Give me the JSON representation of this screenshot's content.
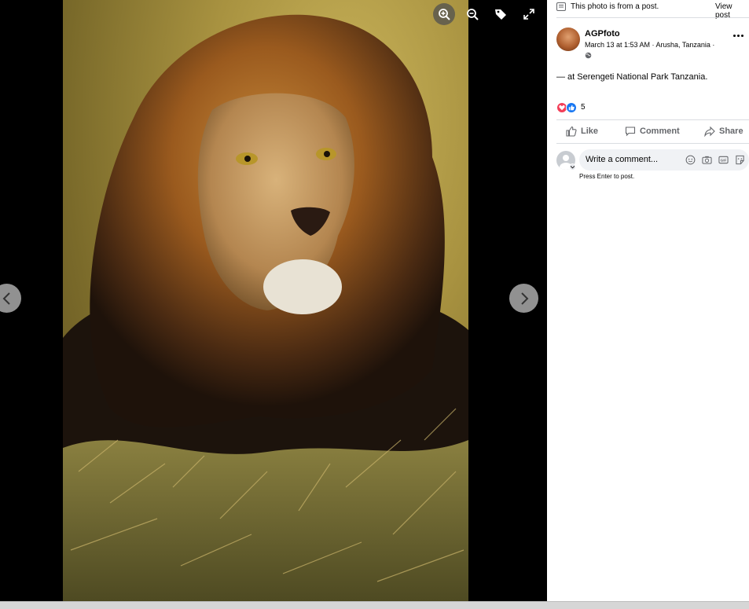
{
  "viewer": {
    "toolbar": {
      "zoom_in": "zoom-in-icon",
      "zoom_out": "zoom-out-icon",
      "tag": "tag-icon",
      "fullscreen": "fullscreen-icon"
    }
  },
  "sidebar": {
    "notice": "This photo is from a post.",
    "view_post": "View post",
    "author": "AGPfoto",
    "meta": "March 13 at 1:53 AM · Arusha, Tanzania ·",
    "caption": "— at Serengeti National Park Tanzania.",
    "reaction_count": "5",
    "actions": {
      "like": "Like",
      "comment": "Comment",
      "share": "Share"
    },
    "comment_placeholder": "Write a comment...",
    "hint": "Press Enter to post."
  },
  "colors": {
    "like_blue": "#1877f2",
    "love_red": "#f33e58",
    "muted_text": "#65676b"
  }
}
